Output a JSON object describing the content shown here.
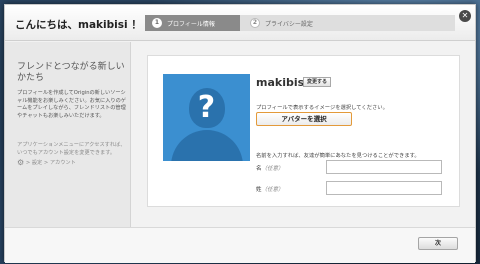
{
  "dialog": {
    "title": "こんにちは、makibisi ！",
    "close_icon": "close-icon"
  },
  "steps": [
    {
      "number": "1",
      "label": "プロフィール情報",
      "active": true
    },
    {
      "number": "2",
      "label": "プライバシー設定",
      "active": false
    }
  ],
  "sidebar": {
    "heading": "フレンドとつながる新しいかたち",
    "text": "プロフィールを作成してOriginの新しいソーシャル機能をお楽しみください。お気に入りのゲームをプレイしながら、フレンドリストの管理やチャットもお楽しみいただけます。",
    "note": "アプリケーションメニューにアクセスすれば、いつでもアカウント設定を変更できます。",
    "path_icon": "gear-icon",
    "path": " > 設定 > アカウント"
  },
  "profile": {
    "username": "makibisi",
    "change_button": "変更する",
    "avatar_desc": "プロフィールで表示するイメージを選択してください。",
    "select_avatar_button": "アバターを選択",
    "name_desc": "名前を入力すれば、友達が簡単にあなたを見つけることができます。",
    "first_name_label": "名",
    "first_name_optional": "（任意）",
    "first_name_value": "",
    "last_name_label": "姓",
    "last_name_optional": "（任意）",
    "last_name_value": ""
  },
  "footer": {
    "next_button": "次"
  },
  "colors": {
    "avatar_bg": "#3b8fd0",
    "step_active": "#8a8a8a",
    "button_highlight": "#e39a3a"
  }
}
